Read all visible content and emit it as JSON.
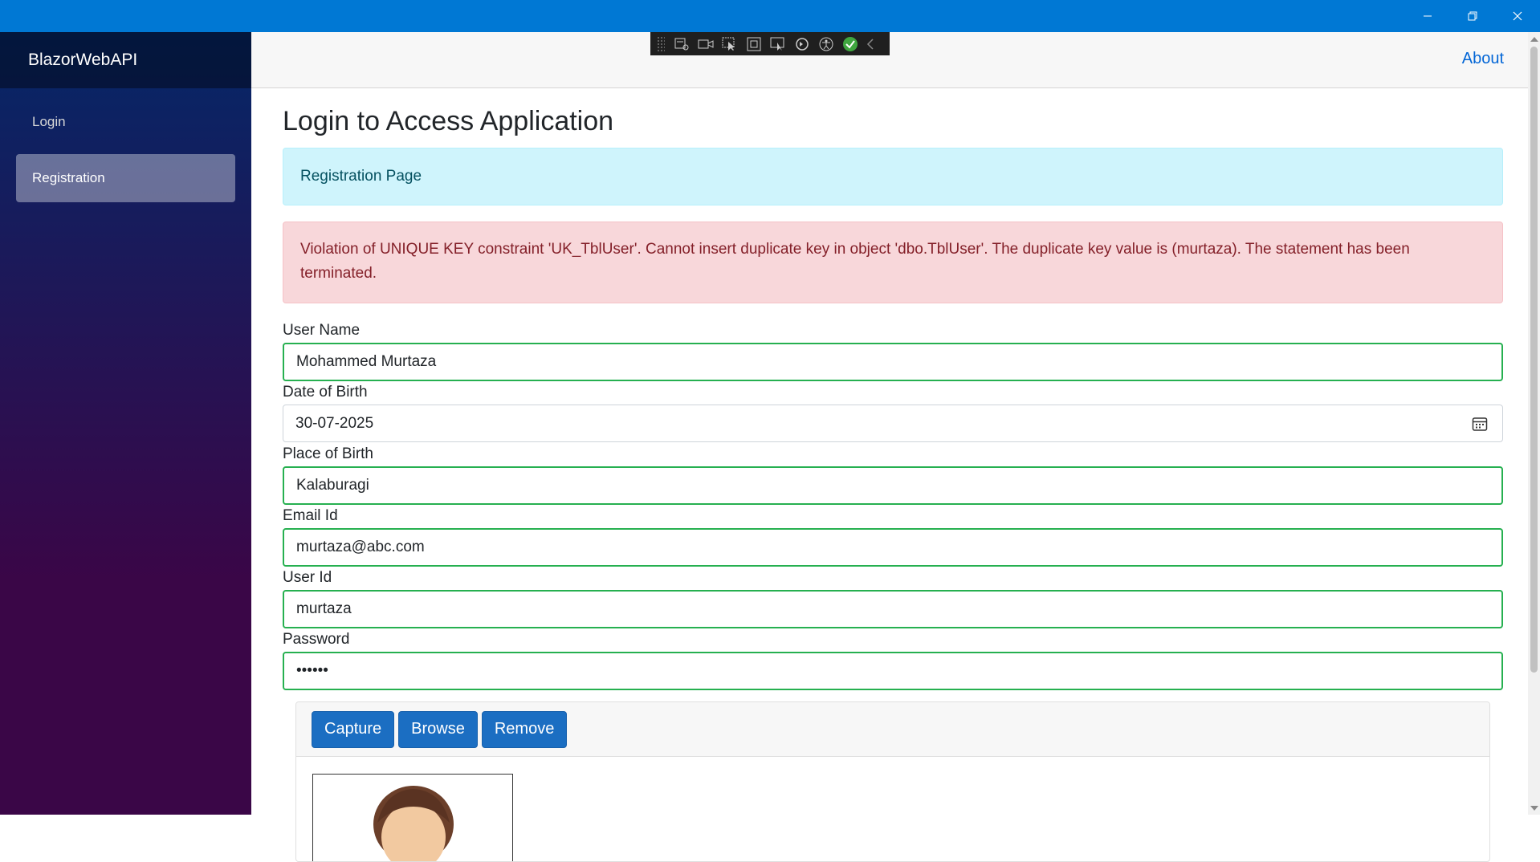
{
  "sidebar": {
    "brand": "BlazorWebAPI",
    "items": [
      {
        "label": "Login"
      },
      {
        "label": "Registration"
      }
    ]
  },
  "topbar": {
    "about": "About"
  },
  "page": {
    "title": "Login to Access Application",
    "info": "Registration Page",
    "error": "Violation of UNIQUE KEY constraint 'UK_TblUser'. Cannot insert duplicate key in object 'dbo.TblUser'. The duplicate key value is (murtaza). The statement has been terminated."
  },
  "form": {
    "user_name_label": "User Name",
    "user_name_value": "Mohammed Murtaza",
    "dob_label": "Date of Birth",
    "dob_value": "30-07-2025",
    "pob_label": "Place of Birth",
    "pob_value": "Kalaburagi",
    "email_label": "Email Id",
    "email_value": "murtaza@abc.com",
    "userid_label": "User Id",
    "userid_value": "murtaza",
    "password_label": "Password",
    "password_value": "••••••"
  },
  "photo_card": {
    "capture": "Capture",
    "browse": "Browse",
    "remove": "Remove"
  },
  "colors": {
    "titlebar": "#0078d4",
    "valid_border": "#26b050",
    "primary_button": "#1b6ec2"
  }
}
